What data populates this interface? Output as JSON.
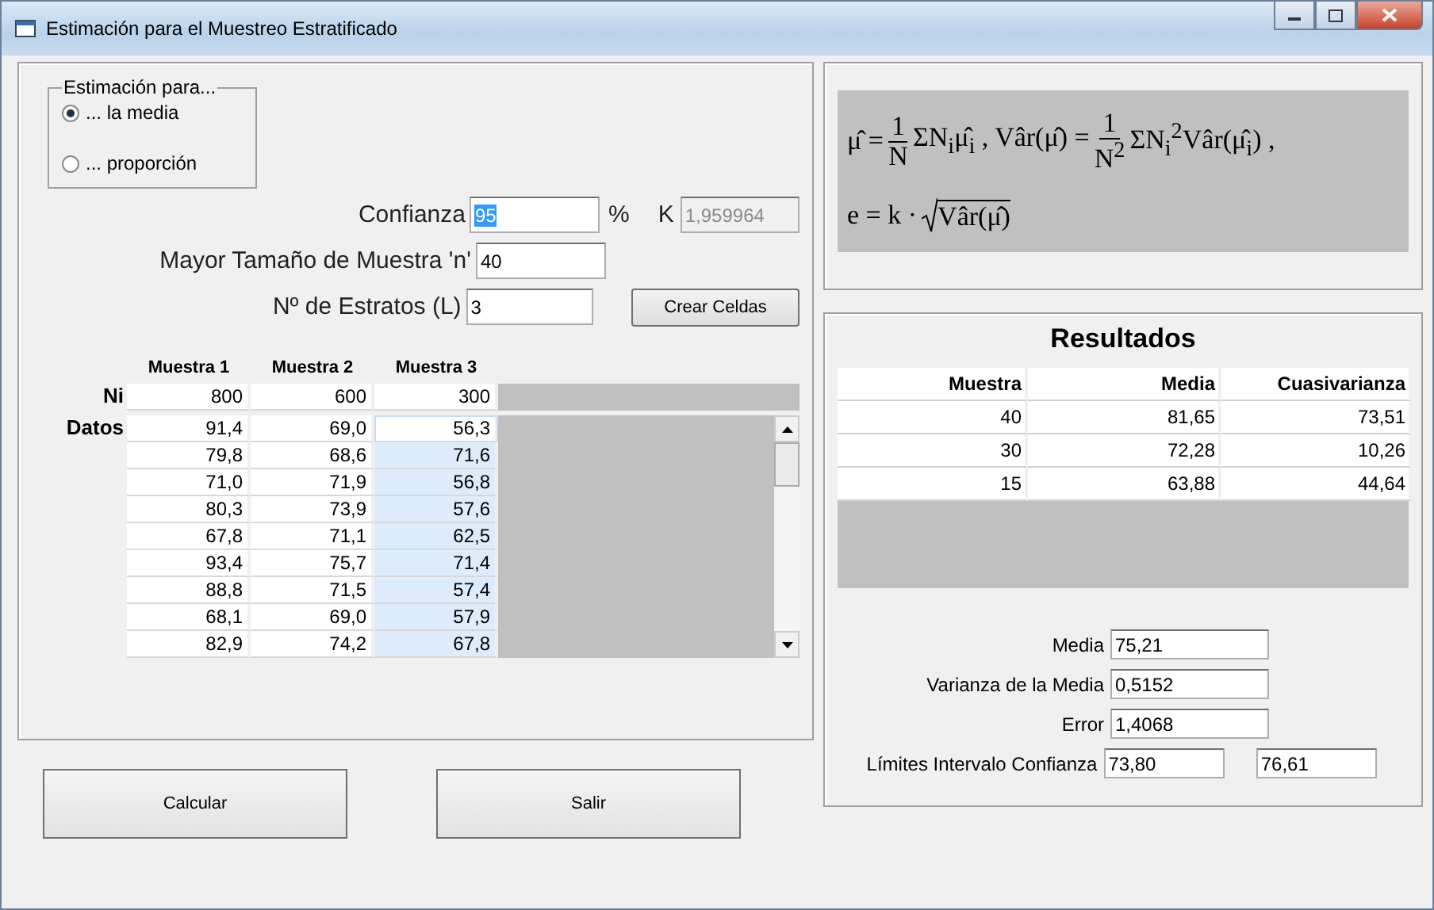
{
  "window": {
    "title": "Estimación para el Muestreo Estratificado"
  },
  "estimation": {
    "legend": "Estimación para...",
    "options": [
      {
        "label": "... la media",
        "selected": true
      },
      {
        "label": "... proporción",
        "selected": false
      }
    ]
  },
  "confianza": {
    "label": "Confianza",
    "value": "95",
    "value_selected": true,
    "unit": "%",
    "k_label": "K",
    "k_value": "1,959964",
    "k_disabled": true
  },
  "sample_size": {
    "label": "Mayor Tamaño de Muestra 'n'",
    "value": "40"
  },
  "strata": {
    "label": "Nº de Estratos (L)",
    "value": "3",
    "button": "Crear Celdas"
  },
  "grid": {
    "columns": [
      {
        "label": "Muestra 1",
        "selected": false
      },
      {
        "label": "Muestra 2",
        "selected": false
      },
      {
        "label": "Muestra 3",
        "selected": true
      }
    ],
    "ni_label": "Ni",
    "ni": [
      "800",
      "600",
      "300"
    ],
    "data_label": "Datos",
    "rows": [
      {
        "values": [
          "91,4",
          "69,0",
          "56,3"
        ],
        "current": true
      },
      {
        "values": [
          "79,8",
          "68,6",
          "71,6"
        ],
        "current": false
      },
      {
        "values": [
          "71,0",
          "71,9",
          "56,8"
        ],
        "current": false
      },
      {
        "values": [
          "80,3",
          "73,9",
          "57,6"
        ],
        "current": false
      },
      {
        "values": [
          "67,8",
          "71,1",
          "62,5"
        ],
        "current": false
      },
      {
        "values": [
          "93,4",
          "75,7",
          "71,4"
        ],
        "current": false
      },
      {
        "values": [
          "88,8",
          "71,5",
          "57,4"
        ],
        "current": false
      },
      {
        "values": [
          "68,1",
          "69,0",
          "57,9"
        ],
        "current": false
      },
      {
        "values": [
          "82,9",
          "74,2",
          "67,8"
        ],
        "current": false
      }
    ]
  },
  "buttons": [
    "Calcular",
    "Salir"
  ],
  "formula": {
    "lines": [
      [
        {
          "kind": "text",
          "text": "μ̂ ="
        },
        {
          "kind": "frac",
          "num": "1",
          "den": "N"
        },
        {
          "kind": "text",
          "text": "ΣN$_{i}$μ̂$_{i}$ , Vâr(μ̂) ="
        },
        {
          "kind": "frac",
          "num": "1",
          "den": "N$^{2}$"
        },
        {
          "kind": "text",
          "text": "ΣN$_{i}$$^{2}$Vâr(μ̂$_{i}$) ,"
        }
      ],
      [
        {
          "kind": "text",
          "text": "e = k ·"
        },
        {
          "kind": "sqrt",
          "text": "Vâr(μ̂)"
        }
      ]
    ]
  },
  "results": {
    "title": "Resultados",
    "columns": [
      "Muestra",
      "Media",
      "Cuasivarianza"
    ],
    "rows": [
      [
        "40",
        "81,65",
        "73,51"
      ],
      [
        "30",
        "72,28",
        "10,26"
      ],
      [
        "15",
        "63,88",
        "44,64"
      ]
    ],
    "fields": [
      {
        "label": "Media",
        "values": [
          "75,21"
        ]
      },
      {
        "label": "Varianza de la Media",
        "values": [
          "0,5152"
        ]
      },
      {
        "label": "Error",
        "values": [
          "1,4068"
        ]
      },
      {
        "label": "Límites Intervalo Confianza",
        "values": [
          "73,80",
          "76,61"
        ]
      }
    ]
  }
}
